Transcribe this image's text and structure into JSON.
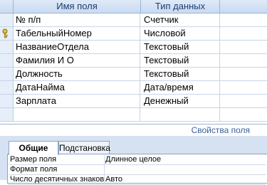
{
  "table": {
    "headers": {
      "field_name": "Имя поля",
      "data_type": "Тип данных"
    },
    "rows": [
      {
        "name": "№ п/п",
        "type": "Счетчик",
        "key": false
      },
      {
        "name": "ТабельныйНомер",
        "type": "Числовой",
        "key": true
      },
      {
        "name": "НазваниеОтдела",
        "type": "Текстовый",
        "key": false
      },
      {
        "name": "Фамилия И О",
        "type": "Текстовый",
        "key": false
      },
      {
        "name": "Должность",
        "type": "Текстовый",
        "key": false
      },
      {
        "name": "ДатаНайма",
        "type": "Дата/время",
        "key": false
      },
      {
        "name": "Зарплата",
        "type": "Денежный",
        "key": false
      }
    ]
  },
  "properties": {
    "title": "Свойства поля",
    "tabs": {
      "general": "Общие",
      "lookup": "Подстановка"
    },
    "rows": [
      {
        "name": "Размер поля",
        "value": "Длинное целое"
      },
      {
        "name": "Формат поля",
        "value": ""
      },
      {
        "name": "Число десятичных знаков",
        "value": "Авто"
      }
    ]
  },
  "colors": {
    "header_bg": "#c9daf1",
    "grid_line": "#c7d4e6",
    "props_bg": "#d6e2f1"
  },
  "icons": {
    "key": "primary-key-icon"
  }
}
